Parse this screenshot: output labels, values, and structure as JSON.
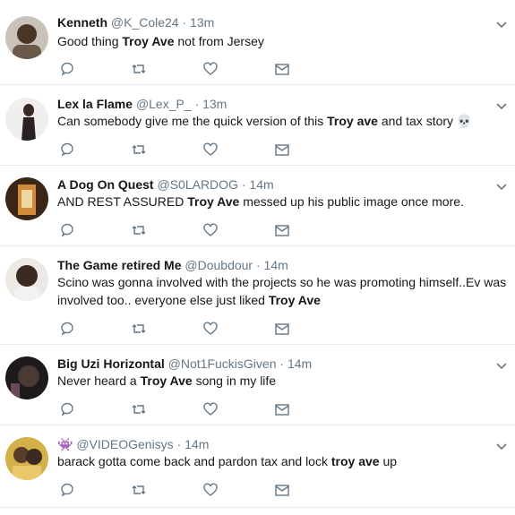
{
  "tweets": [
    {
      "name": "Kenneth",
      "handle": "@K_Cole24",
      "time": "13m",
      "text_parts": [
        "Good thing ",
        "Troy Ave",
        " not from Jersey"
      ],
      "avatar_color": "#6b5a4a"
    },
    {
      "name": "Lex la Flame",
      "handle": "@Lex_P_",
      "time": "13m",
      "text_parts": [
        "Can somebody give me the quick version of this ",
        "Troy ave",
        " and tax story ",
        "💀"
      ],
      "avatar_color": "#e8e4e4"
    },
    {
      "name": "A Dog On Quest",
      "handle": "@S0LARDOG",
      "time": "14m",
      "text_parts": [
        "AND REST ASSURED ",
        "Troy Ave",
        " messed up his public image once more."
      ],
      "avatar_color": "#8a5a30"
    },
    {
      "name": "The Game retired Me",
      "handle": "@Doubdour",
      "time": "14m",
      "text_line1": "Scino was gonna involved with the projects so he was promoting himself..Ev was",
      "text_line2_parts": [
        "involved too.. everyone else just liked ",
        "Troy Ave"
      ],
      "avatar_color": "#3a2a22"
    },
    {
      "name": "Big Uzi Horizontal",
      "handle": "@Not1FuckisGiven",
      "time": "14m",
      "text_parts": [
        "Never heard a ",
        "Troy Ave",
        " song in my life"
      ],
      "avatar_color": "#2a2a2a"
    },
    {
      "name": "👾",
      "handle": "@VIDEOGenisys",
      "time": "14m",
      "text_parts": [
        "barack gotta come back and pardon tax and lock ",
        "troy ave",
        " up"
      ],
      "avatar_color": "#b89a40"
    }
  ],
  "separator": "·",
  "icons": [
    "reply-icon",
    "retweet-icon",
    "like-icon",
    "dm-icon",
    "chevron-down-icon"
  ],
  "colors": {
    "icon_gray": "#657786",
    "name": "#14171a",
    "secondary": "#657786",
    "divider": "#e6ecf0"
  }
}
